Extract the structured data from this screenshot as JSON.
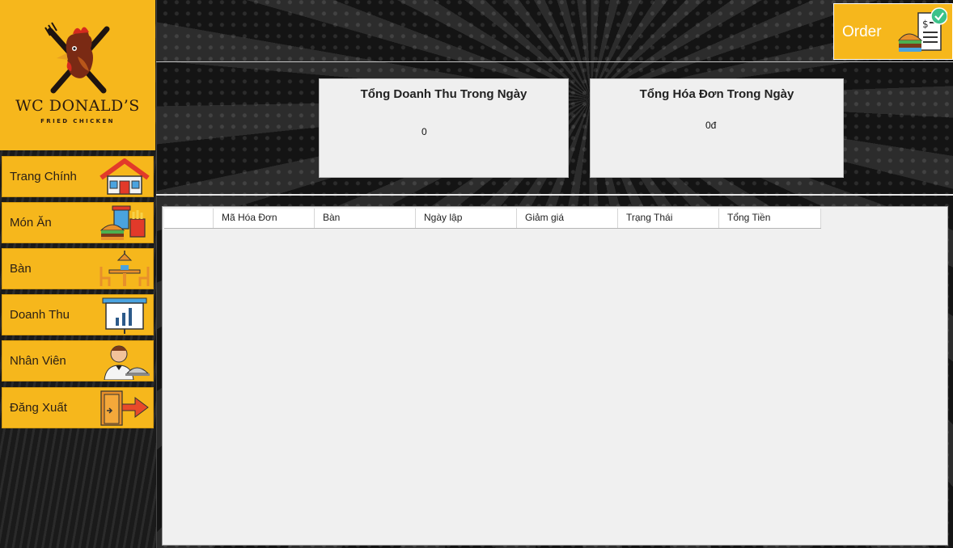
{
  "logo": {
    "title": "WC DONALD’S",
    "subtitle": "FRIED CHICKEN"
  },
  "nav": {
    "items": [
      {
        "label": "Trang Chính",
        "icon": "house-icon"
      },
      {
        "label": "Món Ăn",
        "icon": "burger-drink-icon"
      },
      {
        "label": "Bàn",
        "icon": "dining-table-icon"
      },
      {
        "label": "Doanh Thu",
        "icon": "bar-chart-board-icon"
      },
      {
        "label": "Nhân Viên",
        "icon": "waiter-icon"
      },
      {
        "label": "Đăng Xuất",
        "icon": "exit-door-icon"
      }
    ]
  },
  "order_button": {
    "label": "Order",
    "icon": "burger-receipt-icon"
  },
  "stats": {
    "revenue": {
      "title": "Tổng Doanh Thu Trong Ngày",
      "value": "0"
    },
    "invoices": {
      "title": "Tổng Hóa Đơn Trong Ngày",
      "value": "0đ"
    }
  },
  "table": {
    "columns": [
      "",
      "Mã Hóa Đơn",
      "Bàn",
      "Ngày lập",
      "Giảm giá",
      "Trạng Thái",
      "Tổng Tiền"
    ],
    "rows": []
  },
  "colors": {
    "accent": "#f6b71c",
    "background": "#1b1b1b",
    "panel": "#f0f0f0"
  }
}
